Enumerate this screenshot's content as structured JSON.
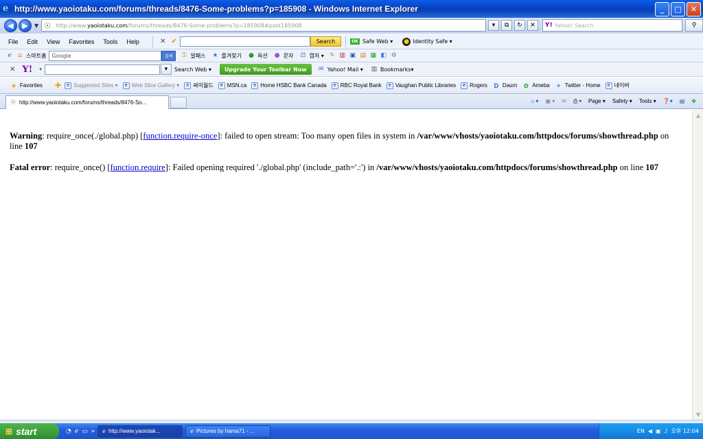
{
  "window": {
    "title": "http://www.yaoiotaku.com/forums/threads/8476-Some-problems?p=185908 - Windows Internet Explorer"
  },
  "address_bar": {
    "url_prefix": "http://www.",
    "url_domain": "yaoiotaku.com",
    "url_path": "/forums/threads/8476-Some-problems?p=185908#post185908",
    "search_placeholder": "Yahoo! Search"
  },
  "menu": {
    "items": [
      "File",
      "Edit",
      "View",
      "Favorites",
      "Tools",
      "Help"
    ],
    "search_label": "Search",
    "safe_web": "Safe Web",
    "identity_safe": "Identity Safe"
  },
  "google_bar": {
    "home_label": "스마트홈",
    "google_text": "Google",
    "go_label": "검색",
    "items": [
      "알패스",
      "즐겨찾기",
      "옥션",
      "문자",
      "캡처"
    ]
  },
  "yahoo_bar": {
    "search_web": "Search Web",
    "upgrade": "Upgrade Your Toolbar Now",
    "yahoo_mail": "Yahoo! Mail",
    "bookmarks": "Bookmarks"
  },
  "favorites_bar": {
    "favorites_label": "Favorites",
    "items": [
      "Suggested Sites",
      "Web Slice Gallery",
      "싸이월드",
      "MSN.ca",
      "Home HSBC Bank Canada",
      "RBC Royal Bank",
      "Vaughan Public Libraries",
      "Rogers",
      "Daum",
      "Ameba",
      "Twitter - Home",
      "네이버"
    ]
  },
  "tabs": {
    "active_tab": "http://www.yaoiotaku.com/forums/threads/8476-So...",
    "commands": [
      "Page",
      "Safety",
      "Tools"
    ]
  },
  "content": {
    "warning_label": "Warning",
    "warning_text_1": ": require_once(./global.php) [",
    "warning_link": "function.require-once",
    "warning_text_2": "]: failed to open stream: Too many open files in system in ",
    "warning_path": "/var/www/vhosts/yaoiotaku.com/httpdocs/forums/showthread.php",
    "warning_online": " on line ",
    "warning_line": "107",
    "fatal_label": "Fatal error",
    "fatal_text_1": ": require_once() [",
    "fatal_link": "function.require",
    "fatal_text_2": "]: Failed opening required './global.php' (include_path='.:') in ",
    "fatal_path": "/var/www/vhosts/yaoiotaku.com/httpdocs/forums/showthread.php",
    "fatal_online": " on line ",
    "fatal_line": "107"
  },
  "taskbar": {
    "start_label": "start",
    "tasks": [
      "http://www.yaoiotak...",
      "Pictures by hama71 - ..."
    ],
    "lang": "EN",
    "clock": "오후 12:04"
  }
}
